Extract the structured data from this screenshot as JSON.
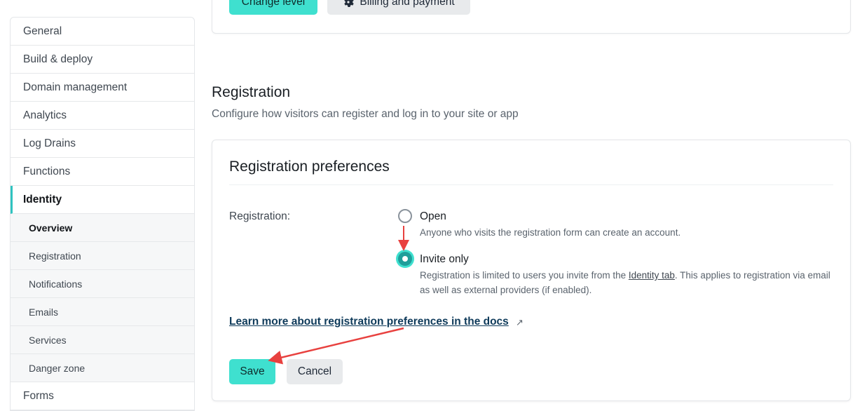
{
  "sidebar": {
    "items": [
      {
        "label": "General"
      },
      {
        "label": "Build & deploy"
      },
      {
        "label": "Domain management"
      },
      {
        "label": "Analytics"
      },
      {
        "label": "Log Drains"
      },
      {
        "label": "Functions"
      },
      {
        "label": "Identity"
      }
    ],
    "identity_sub": [
      {
        "label": "Overview"
      },
      {
        "label": "Registration"
      },
      {
        "label": "Notifications"
      },
      {
        "label": "Emails"
      },
      {
        "label": "Services"
      },
      {
        "label": "Danger zone"
      }
    ],
    "after": [
      {
        "label": "Forms"
      }
    ]
  },
  "top_card": {
    "change_level": "Change level",
    "billing": "Billing and payment"
  },
  "section": {
    "title": "Registration",
    "description": "Configure how visitors can register and log in to your site or app"
  },
  "card": {
    "title": "Registration preferences",
    "field_label": "Registration:",
    "option_open": {
      "label": "Open",
      "help": "Anyone who visits the registration form can create an account.",
      "selected": false
    },
    "option_invite": {
      "label": "Invite only",
      "help_before": "Registration is limited to users you invite from the ",
      "help_link": "Identity tab",
      "help_after": ". This applies to registration via email as well as external providers (if enabled).",
      "selected": true
    },
    "docs_link": "Learn more about registration preferences in the docs",
    "docs_link_icon": "↗",
    "save": "Save",
    "cancel": "Cancel"
  },
  "colors": {
    "accent": "#3fe0cf",
    "accent_dark": "#1f9e9a",
    "annotation_arrow": "#e8413f"
  }
}
